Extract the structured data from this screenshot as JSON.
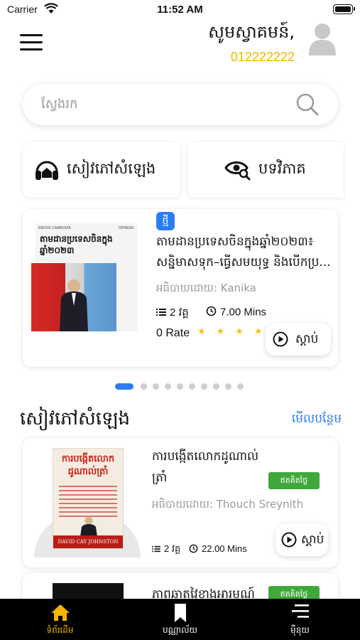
{
  "status_bar": {
    "carrier": "Carrier",
    "time": "11:52 AM"
  },
  "header": {
    "greeting": "សូមស្វាគមន៍,",
    "phone": "012222222"
  },
  "search": {
    "placeholder": "ស្វែងរក"
  },
  "quick_links": [
    {
      "label": "សៀវភៅសំឡេង",
      "icon": "headphones-icon"
    },
    {
      "label": "បទវិភាគ",
      "icon": "eye-search-icon"
    }
  ],
  "featured": {
    "badge": "ថ្មី",
    "cover": {
      "brand": "EBOOK CAMBODIA",
      "tag": "OPINION",
      "title": "តាមដានប្រទេសចិនក្នុងឆ្នាំ២០២៣"
    },
    "title": "តាមដានប្រទេសចិនក្នុងឆ្នាំ២០២៣៖ សន្និមាសទុក–ធ្វើសមយុទ្ធ និងបើកប្រ...",
    "author": "អធិបាយដោយ: Kanika",
    "episodes": "2 វគ្គ",
    "duration": "7.00 Mins",
    "rate": "0 Rate",
    "stars": 5,
    "listen_label": "ស្ដាប់"
  },
  "carousel": {
    "count": 10,
    "active": 0
  },
  "section": {
    "title": "សៀវភៅសំឡេង",
    "see_more": "មើលបន្ថែម"
  },
  "books": [
    {
      "cover_title": "ការបង្កើតលោក ដូណាល់ត្រាំ",
      "cover_author": "DAVID CAY JOHNSTON",
      "title": "ការបង្កើតលោកដូណាល់ ត្រាំ",
      "badge": "ឥតគិតថ្លៃ",
      "author": "អធិបាយដោយ: Thouch Sreynith",
      "episodes": "2 វគ្គ",
      "duration": "22.00 Mins",
      "listen_label": "ស្ដាប់"
    },
    {
      "title": "ភាពឆាតវៃខាងអារម្មណ៍",
      "badge": "ឥតគិតថ្លៃ"
    }
  ],
  "tabs": [
    {
      "label": "ទំព័រដើម",
      "icon": "home-icon",
      "active": true
    },
    {
      "label": "បណ្ណាល័យ",
      "icon": "bookmark-icon",
      "active": false
    },
    {
      "label": "ម៉ឺនុយ",
      "icon": "menu-lines-icon",
      "active": false
    }
  ],
  "colors": {
    "accent": "#2d7cf6",
    "phone": "#f5b400",
    "free_badge": "#3fa83a",
    "tabbar": "#000000",
    "star": "#f2c21b"
  }
}
